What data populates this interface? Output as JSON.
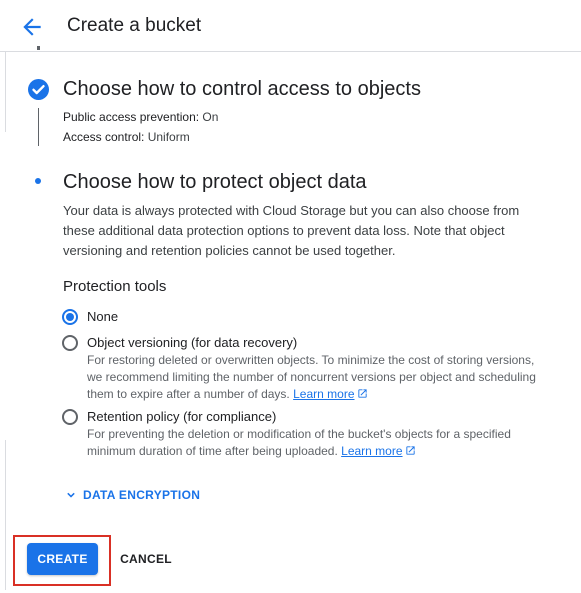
{
  "header": {
    "title": "Create a bucket"
  },
  "step_access": {
    "title": "Choose how to control access to objects",
    "public_access_label": "Public access prevention:",
    "public_access_value": "On",
    "access_control_label": "Access control:",
    "access_control_value": "Uniform"
  },
  "step_protect": {
    "title": "Choose how to protect object data",
    "description": "Your data is always protected with Cloud Storage but you can also choose from these additional data protection options to prevent data loss. Note that object versioning and retention policies cannot be used together.",
    "tools_title": "Protection tools",
    "options": [
      {
        "label": "None",
        "selected": true,
        "help": ""
      },
      {
        "label": "Object versioning (for data recovery)",
        "selected": false,
        "help": "For restoring deleted or overwritten objects. To minimize the cost of storing versions, we recommend limiting the number of noncurrent versions per object and scheduling them to expire after a number of days.",
        "link": "Learn more"
      },
      {
        "label": "Retention policy (for compliance)",
        "selected": false,
        "help": "For preventing the deletion or modification of the bucket's objects for a specified minimum duration of time after being uploaded.",
        "link": "Learn more"
      }
    ]
  },
  "encryption": {
    "label": "DATA ENCRYPTION"
  },
  "actions": {
    "create": "CREATE",
    "cancel": "CANCEL"
  },
  "colors": {
    "accent": "#1a73e8",
    "highlight": "#d93025"
  }
}
